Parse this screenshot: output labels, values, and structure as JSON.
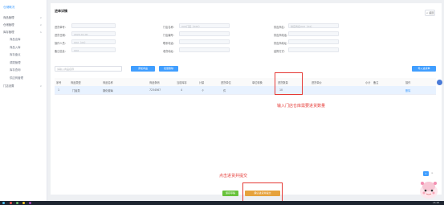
{
  "sidebar": {
    "brand": "仓储概况",
    "items": [
      {
        "label": "商品管理",
        "arrow": "∨"
      },
      {
        "label": "仓储管理",
        "arrow": "∨"
      },
      {
        "label": "库存管理",
        "arrow": "∧"
      }
    ],
    "subitems": [
      {
        "label": "商品出库",
        "active": false
      },
      {
        "label": "商品入库",
        "active": false
      },
      {
        "label": "库存盘点",
        "active": false
      },
      {
        "label": "调拨管理",
        "active": false
      },
      {
        "label": "库存查询",
        "active": false
      },
      {
        "label": "供应商管理",
        "active": false
      }
    ],
    "last_item": {
      "label": "门店设置",
      "arrow": "∨"
    }
  },
  "page": {
    "title": "进单详情",
    "back": "< 返回"
  },
  "form": {
    "row1": [
      {
        "label": "进货单号:",
        "value": ""
      },
      {
        "label": "门店名称:",
        "value": "XXX门店（XXX）"
      },
      {
        "label": "供应商名:",
        "value": "供应商名XXX（XX）"
      }
    ],
    "row2": [
      {
        "label": "进货日期:",
        "value": "2024-01-00"
      },
      {
        "label": "门店编号:",
        "value": ""
      },
      {
        "label": "供应商电话:",
        "value": ""
      }
    ],
    "row3": [
      {
        "label": "操作人员:",
        "value": "XXX（XX）"
      },
      {
        "label": "联系电话:",
        "value": ""
      },
      {
        "label": "供应商地址:",
        "value": ""
      }
    ],
    "row4": [
      {
        "label": "备注信息:",
        "value": "XXX"
      },
      {
        "label": "收货地址:",
        "value": ""
      },
      {
        "label": "结算方式:",
        "value": ""
      }
    ]
  },
  "toolbar": {
    "search_placeholder": "请输入商品名称",
    "btn1": "添加商品",
    "btn2": "批量删除",
    "btn_right": "导入进货单"
  },
  "table": {
    "headers": [
      "序号",
      "商品类型",
      "商品名称",
      "商品条码",
      "当前库存",
      "计量",
      "进货单位",
      "单位转换",
      "进货数量",
      "进货单价",
      "小计",
      "备注",
      "操作"
    ],
    "rows": [
      [
        "1",
        "门窗类",
        "钢化玻璃",
        "7234567",
        "4",
        "个",
        "件",
        "",
        "10",
        "",
        "",
        "",
        "删除"
      ]
    ]
  },
  "annotations": {
    "note1": "输入门店仓库需要进货数量",
    "note2": "点击进货并提交"
  },
  "footer": {
    "save_btn": "保存草稿",
    "submit_btn": "确认进货并提交"
  },
  "pager": {
    "current": "1",
    "more": ">"
  },
  "taskbar": {
    "time": "15:28"
  },
  "colors": {
    "primary": "#409eff",
    "success": "#67c23a",
    "warning": "#e6a23c",
    "annotation": "#e53935"
  }
}
